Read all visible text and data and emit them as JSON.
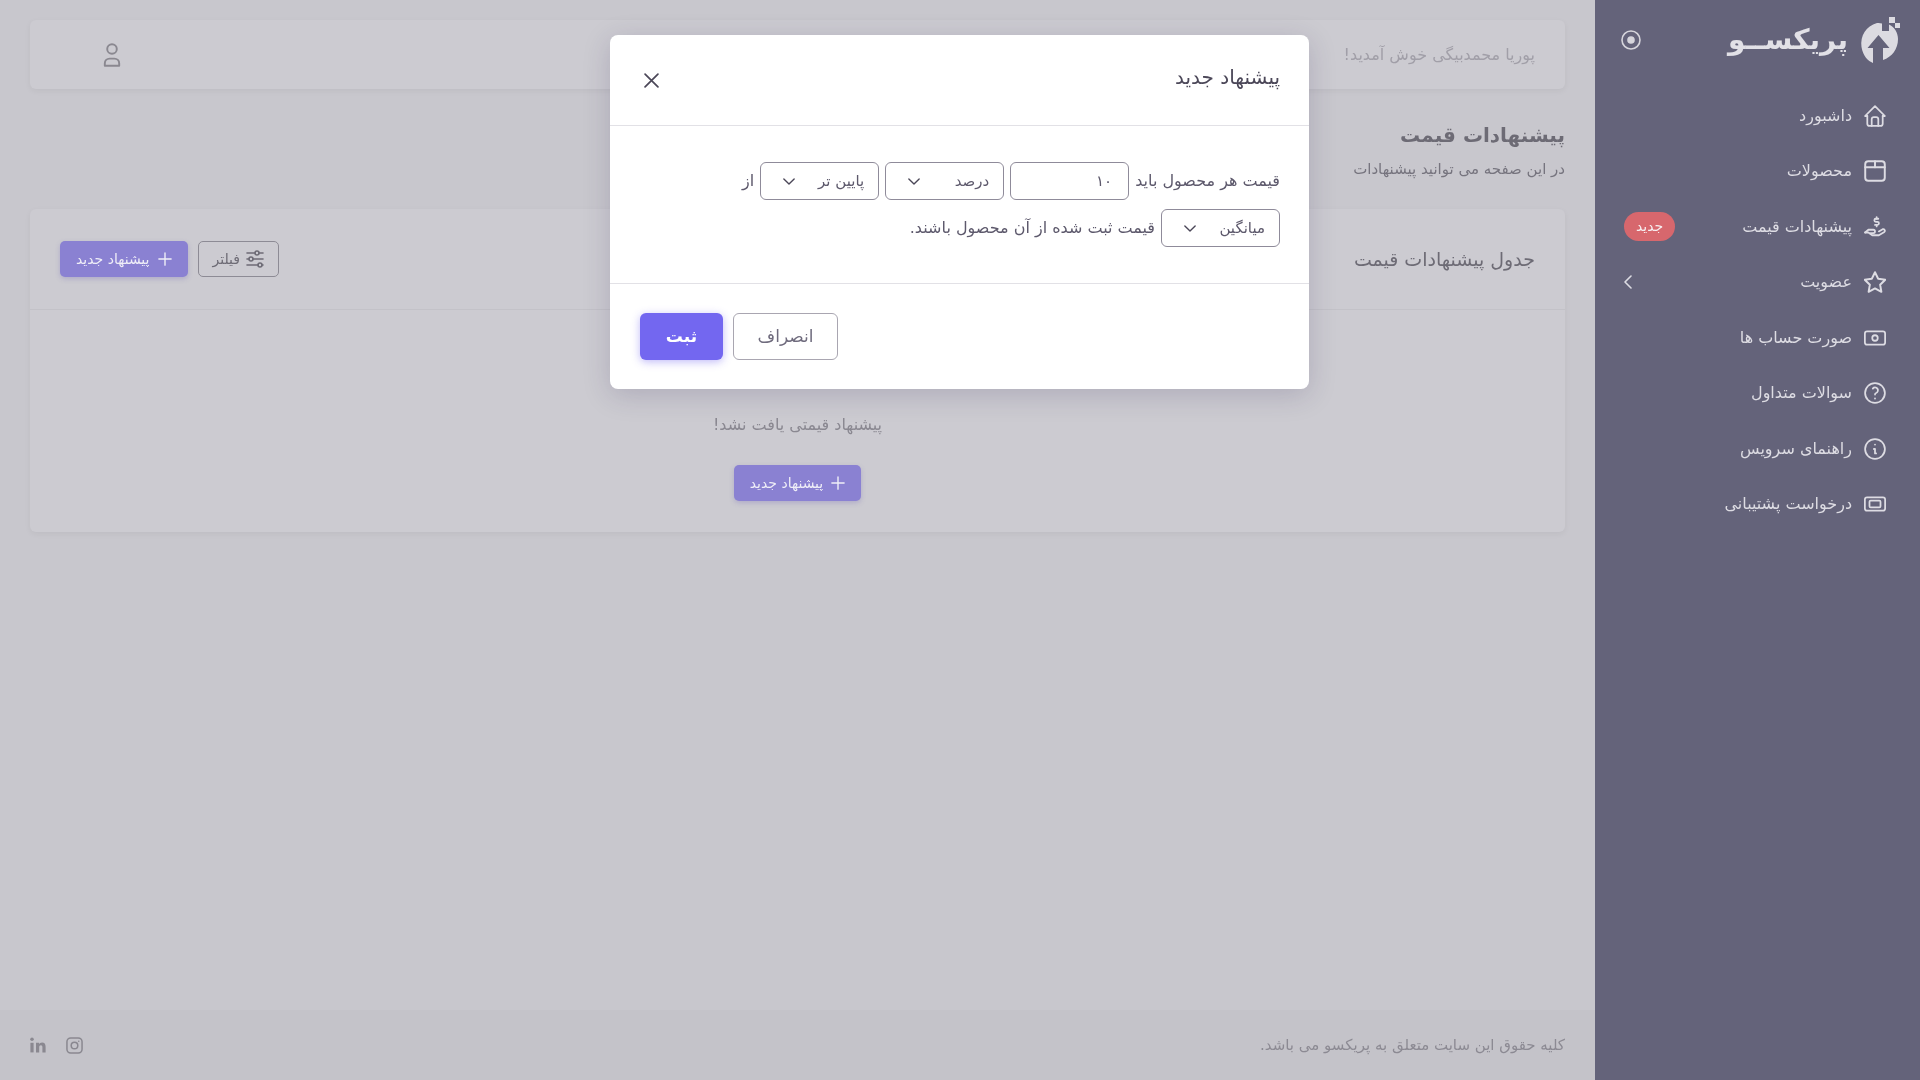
{
  "sidebar": {
    "brand": "پریکســو",
    "items": [
      {
        "label": "داشبورد",
        "kind": "link"
      },
      {
        "label": "محصولات",
        "kind": "link"
      },
      {
        "label": "پیشنهادات قیمت",
        "kind": "link",
        "badge": "جدید"
      },
      {
        "label": "عضویت",
        "kind": "group",
        "expanded": false
      },
      {
        "label": "صورت حساب ها",
        "kind": "link"
      },
      {
        "label": "سوالات متداول",
        "kind": "link"
      },
      {
        "label": "راهنمای سرویس",
        "kind": "link"
      },
      {
        "label": "درخواست پشتیبانی",
        "kind": "link"
      }
    ]
  },
  "header": {
    "greeting": "پوریا محمدبیگی خوش آمدید!"
  },
  "page": {
    "title": "پیشنهادات قیمت",
    "subtitle": "در این صفحه می توانید پیشنهادات"
  },
  "table_card": {
    "title": "جدول پیشنهادات قیمت",
    "buttons": [
      {
        "label": "فیلتر",
        "kind": "outline"
      },
      {
        "label": "پیشنهاد جدید",
        "kind": "primary"
      }
    ],
    "empty_message": "پیشنهاد قیمتی یافت نشد!",
    "empty_button": {
      "label": "پیشنهاد جدید",
      "kind": "primary"
    }
  },
  "footer": {
    "copyright": "کلیه حقوق این سایت متعلق به پریکسو می باشد."
  },
  "modal": {
    "title": "پیشنهاد جدید",
    "rows": [
      [
        {
          "kind": "text",
          "text": "قیمت هر محصول باید"
        },
        {
          "kind": "input",
          "value": "۱۰"
        },
        {
          "kind": "select",
          "value": "درصد"
        },
        {
          "kind": "select",
          "value": "پایین تر"
        },
        {
          "kind": "text",
          "text": "از"
        }
      ],
      [
        {
          "kind": "select",
          "value": "میانگین"
        },
        {
          "kind": "text",
          "text": "قیمت ثبت شده از آن محصول باشند."
        }
      ]
    ],
    "buttons": [
      {
        "label": "انصراف",
        "kind": "outline"
      },
      {
        "label": "ثبت",
        "kind": "primary"
      }
    ]
  }
}
